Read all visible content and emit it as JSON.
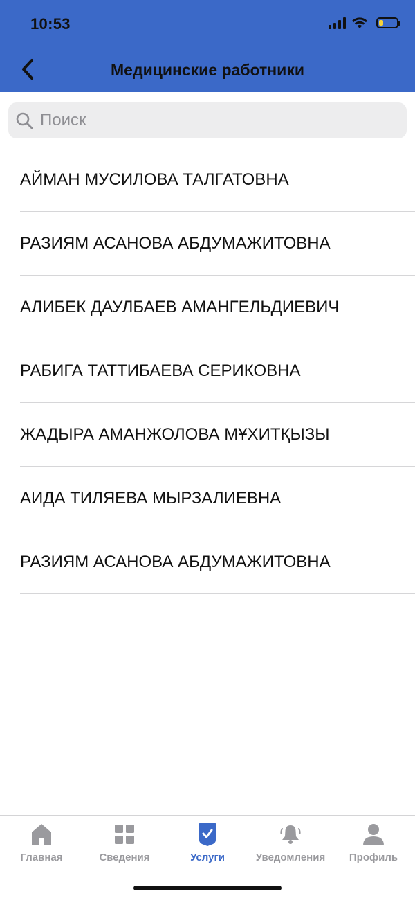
{
  "status_bar": {
    "time": "10:53"
  },
  "header": {
    "title": "Медицинские работники",
    "background": "#3b69c8"
  },
  "search": {
    "placeholder": "Поиск",
    "value": ""
  },
  "workers": [
    {
      "name": "АЙМАН МУСИЛОВА ТАЛГАТОВНА"
    },
    {
      "name": "РАЗИЯМ АСАНОВА АБДУМАЖИТОВНА"
    },
    {
      "name": "АЛИБЕК ДАУЛБАЕВ АМАНГЕЛЬДИЕВИЧ"
    },
    {
      "name": "РАБИГА ТАТТИБАЕВА СЕРИКОВНА"
    },
    {
      "name": "ЖАДЫРА АМАНЖОЛОВА МҰХИТҚЫЗЫ"
    },
    {
      "name": "АИДА ТИЛЯЕВА МЫРЗАЛИЕВНА"
    },
    {
      "name": "РАЗИЯМ АСАНОВА АБДУМАЖИТОВНА"
    }
  ],
  "tabbar": {
    "active_color": "#3b69c8",
    "inactive_color": "#9a9a9e",
    "tabs": [
      {
        "label": "Главная",
        "icon": "home-icon",
        "active": false
      },
      {
        "label": "Сведения",
        "icon": "grid-icon",
        "active": false
      },
      {
        "label": "Услуги",
        "icon": "services-check-icon",
        "active": true
      },
      {
        "label": "Уведомления",
        "icon": "bell-icon",
        "active": false
      },
      {
        "label": "Профиль",
        "icon": "profile-icon",
        "active": false
      }
    ]
  }
}
